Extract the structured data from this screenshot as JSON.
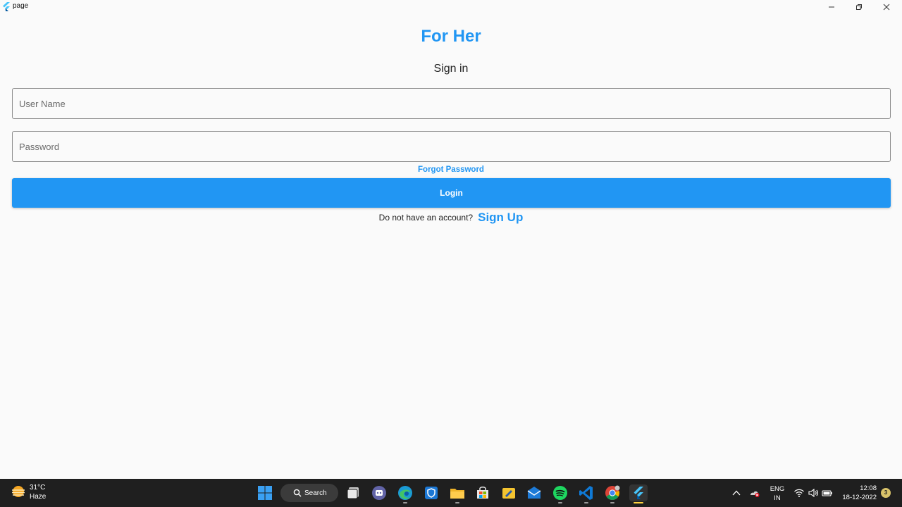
{
  "window": {
    "title": "page",
    "icon": "flutter-icon",
    "controls": [
      "minimize-icon",
      "restore-icon",
      "close-icon"
    ]
  },
  "main": {
    "brand_title": "For Her",
    "subtitle": "Sign in",
    "username_placeholder": "User Name",
    "username_value": "",
    "password_placeholder": "Password",
    "password_value": "",
    "forgot_label": "Forgot Password",
    "login_label": "Login",
    "signup_question": "Do not have an account?",
    "signup_link": "Sign Up"
  },
  "colors": {
    "accent": "#2196f3",
    "background": "#fafafa",
    "taskbar": "#1f1f1f"
  },
  "taskbar": {
    "weather": {
      "temp": "31°C",
      "condition": "Haze",
      "icon": "hazy-sun-icon"
    },
    "search_label": "Search",
    "pinned": [
      "windows-start-icon",
      "task-view-icon",
      "teams-chat-icon",
      "edge-icon",
      "defender-icon",
      "file-explorer-icon",
      "microsoft-store-icon",
      "sticky-folder-icon",
      "mail-icon",
      "spotify-icon",
      "vscode-icon",
      "chrome-icon",
      "flutter-icon"
    ],
    "tray": {
      "language_line1": "ENG",
      "language_line2": "IN",
      "time": "12:08",
      "date": "18-12-2022",
      "notifications": "3"
    }
  }
}
